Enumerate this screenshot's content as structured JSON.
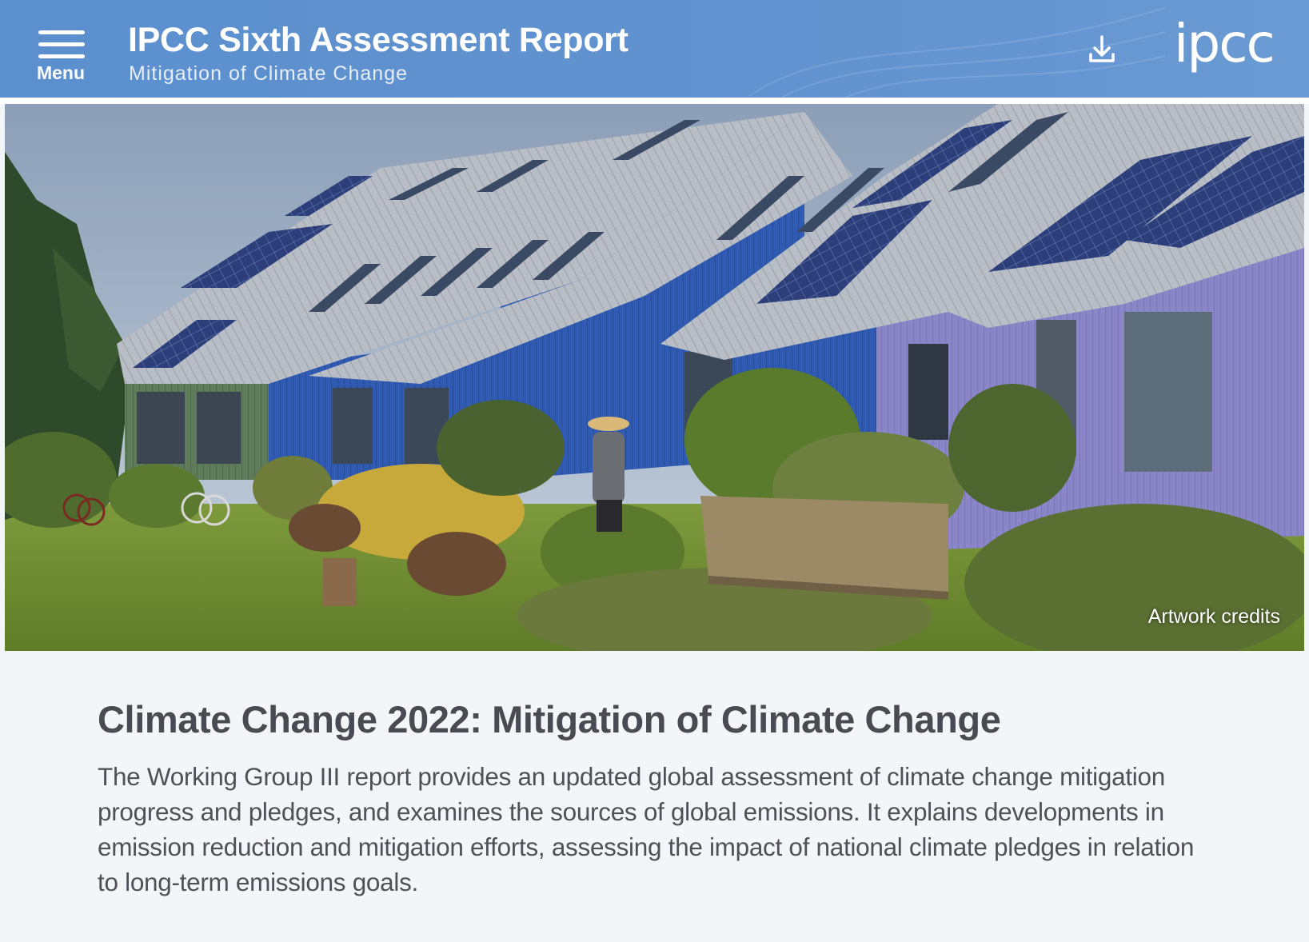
{
  "header": {
    "menu_label": "Menu",
    "title": "IPCC Sixth Assessment Report",
    "subtitle": "Mitigation of Climate Change",
    "logo_text": "ipcc",
    "download_icon": "download-icon",
    "menu_icon": "hamburger-icon"
  },
  "hero": {
    "alt": "Terraced houses with solar panels and a community garden",
    "credits_label": "Artwork credits"
  },
  "main": {
    "heading": "Climate Change 2022: Mitigation of Climate Change",
    "description": "The Working Group III report provides an updated global assessment of climate change mitigation progress and pledges, and examines the sources of global emissions. It explains developments in emission reduction and mitigation efforts, assessing the impact of national climate pledges in relation to long-term emissions goals."
  },
  "colors": {
    "header_bg": "#5b8fcd",
    "page_bg": "#f4f5f9",
    "text": "#4a4a52"
  }
}
